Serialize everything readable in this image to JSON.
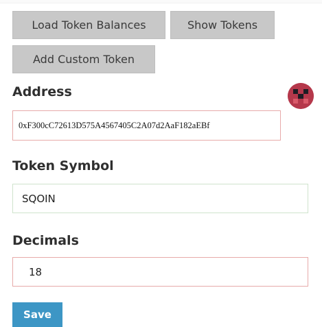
{
  "toolbar": {
    "load_balances_label": "Load Token Balances",
    "show_tokens_label": "Show Tokens",
    "add_custom_token_label": "Add Custom Token"
  },
  "form": {
    "address": {
      "label": "Address",
      "value": "0xF300cC72613D575A4567405C2A07d2AaF182aEBf"
    },
    "token_symbol": {
      "label": "Token Symbol",
      "value": "SQOIN"
    },
    "decimals": {
      "label": "Decimals",
      "value": "18"
    },
    "save_label": "Save"
  },
  "colors": {
    "button_gray": "#c8c8c8",
    "invalid_border": "#e7aaa9",
    "valid_border": "#cfe3cc",
    "save_blue": "#3d96c5",
    "identicon_red": "#b5384b"
  },
  "icons": {
    "address_identicon": "identicon"
  }
}
